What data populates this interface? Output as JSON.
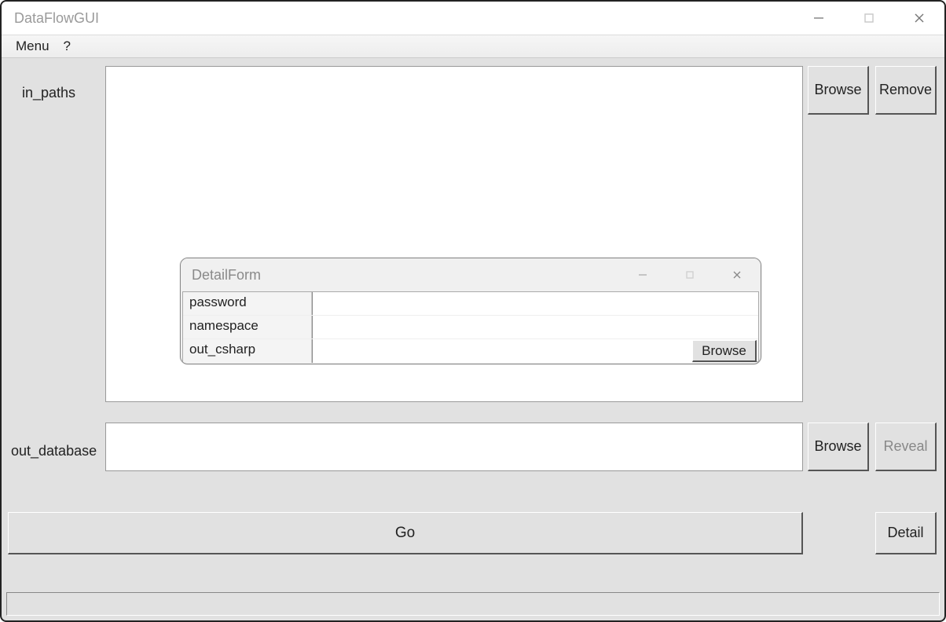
{
  "window": {
    "title": "DataFlowGUI"
  },
  "menubar": {
    "items": [
      "Menu",
      "?"
    ]
  },
  "main": {
    "in_paths": {
      "label": "in_paths",
      "value": "",
      "browse_label": "Browse",
      "remove_label": "Remove"
    },
    "out_database": {
      "label": "out_database",
      "value": "",
      "browse_label": "Browse",
      "reveal_label": "Reveal"
    },
    "go_label": "Go",
    "detail_label": "Detail"
  },
  "dialog": {
    "title": "DetailForm",
    "rows": {
      "password": {
        "label": "password",
        "value": ""
      },
      "namespace": {
        "label": "namespace",
        "value": ""
      },
      "out_csharp": {
        "label": "out_csharp",
        "value": "",
        "browse_label": "Browse"
      }
    }
  },
  "statusbar": {
    "text": ""
  }
}
